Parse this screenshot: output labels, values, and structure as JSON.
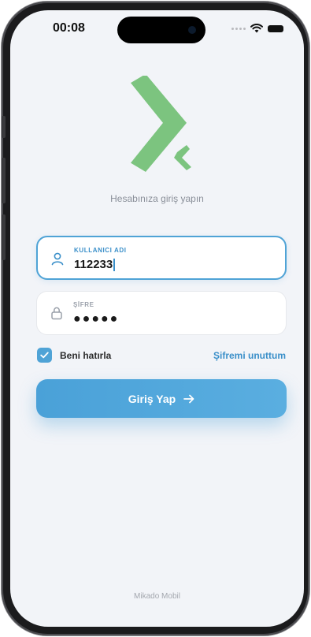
{
  "status_bar": {
    "time": "00:08",
    "icons": [
      "signal-icon",
      "wifi-icon",
      "battery-icon"
    ]
  },
  "brand": {
    "logo_color": "#7cc47f",
    "accent_color": "#4fa3d6"
  },
  "login": {
    "subtitle": "Hesabınıza giriş yapın",
    "username": {
      "label": "KULLANICI ADI",
      "value": "112233"
    },
    "password": {
      "label": "ŞİFRE",
      "value": "●●●●●"
    },
    "remember_me": {
      "label": "Beni hatırla",
      "checked": true
    },
    "forgot_password": "Şifremi unuttum",
    "submit_label": "Giriş Yap"
  },
  "footer": {
    "text": "Mikado Mobil"
  }
}
